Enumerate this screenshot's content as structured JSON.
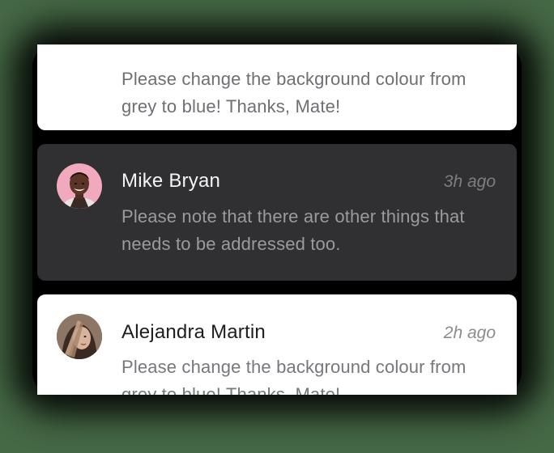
{
  "notifications": [
    {
      "message": "Please change the background colour from grey to blue! Thanks, Mate!"
    },
    {
      "name": "Mike Bryan",
      "time": "3h ago",
      "message": "Please note that there are other things that needs to be addressed too.",
      "avatar_icon": "avatar-mike-bryan",
      "theme": "dark"
    },
    {
      "name": "Alejandra Martin",
      "time": "2h ago",
      "message": "Please change the background colour from grey to blue! Thanks, Mate!",
      "avatar_icon": "avatar-alejandra-martin",
      "theme": "light"
    }
  ],
  "colors": {
    "page_background": "#456845",
    "card_light": "#ffffff",
    "card_dark": "#303033"
  }
}
